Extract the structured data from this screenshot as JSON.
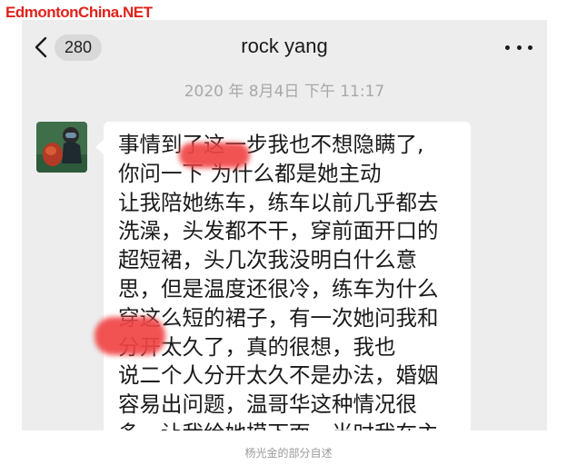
{
  "watermark": "EdmontonChina.NET",
  "header": {
    "unread_count": "280",
    "contact_name": "rock yang"
  },
  "timestamp": "2020 年 8月4日  下午 11:17",
  "message": {
    "text": "事情到了这一步我也不想隐瞒了,\n你问一下       为什么都是她主动\n让我陪她练车，练车以前几乎都去\n洗澡，头发都不干，穿前面开口的\n超短裙，头几次我没明白什么意\n思，但是温度还很冷，练车为什么\n穿这么短的裙子，有一次她问我和\n       分开太久了，真的很想，我也\n说二个人分开太久不是办法，婚姻\n容易出问题，温哥华这种情况很\n多，让我给她摸下面，当时我在主"
  },
  "caption": "杨光金的部分自述",
  "colors": {
    "watermark": "#e0221b",
    "chat_background": "#ededed",
    "bubble": "#ffffff",
    "redaction": "#f04545"
  },
  "icons": [
    "back-chevron-icon",
    "more-dots-icon"
  ]
}
